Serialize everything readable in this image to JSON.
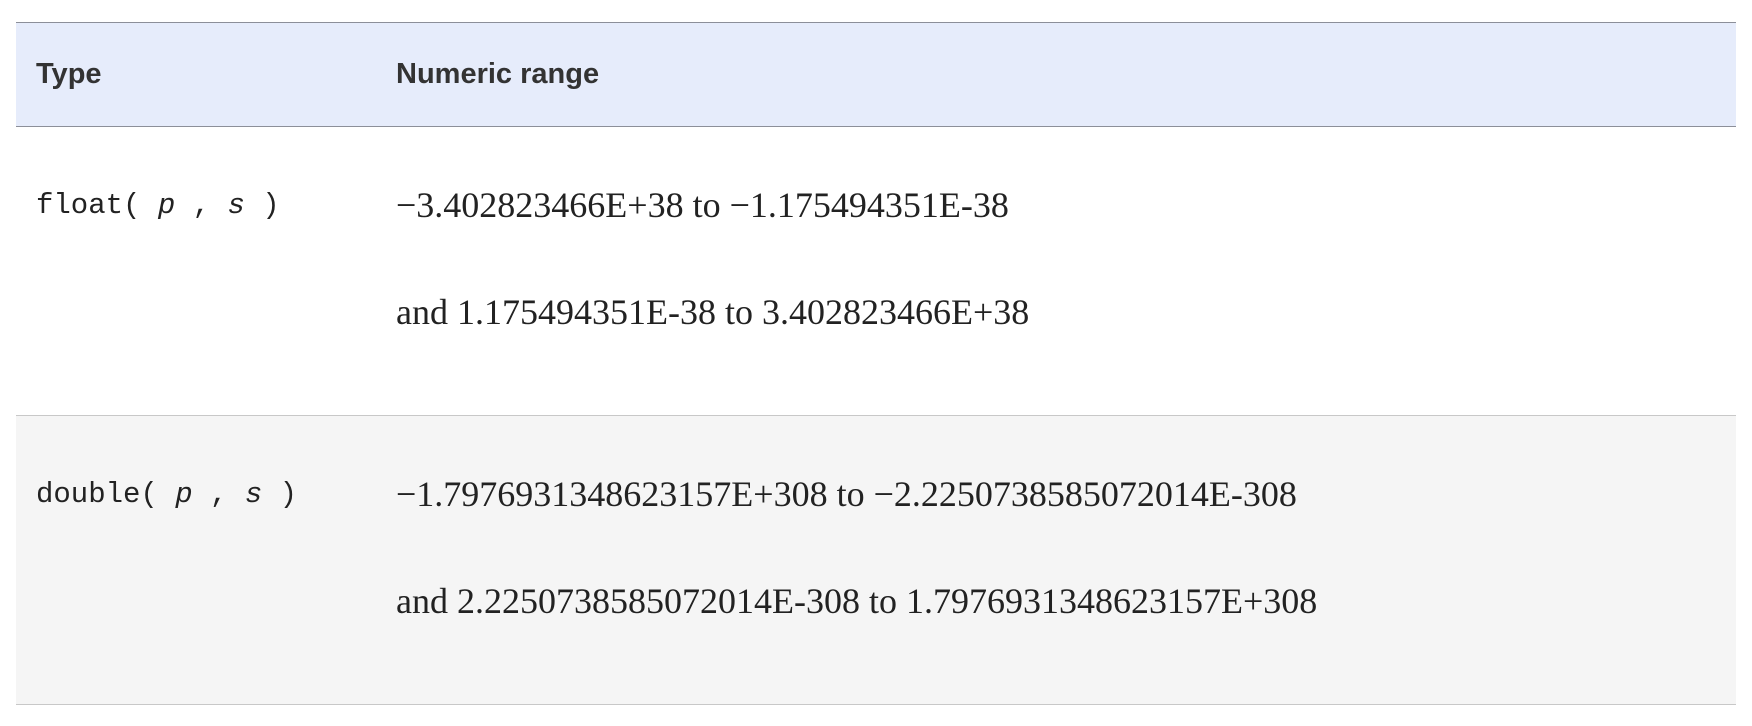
{
  "table": {
    "headers": [
      "Type",
      "Numeric range"
    ],
    "rows": [
      {
        "type_name": "float",
        "type_open": "( ",
        "param_p": "p",
        "separator": " , ",
        "param_s": "s",
        "type_close": " )",
        "range_line_1": "−3.402823466E+38 to −1.175494351E-38",
        "range_line_2": "and 1.175494351E-38 to 3.402823466E+38"
      },
      {
        "type_name": "double",
        "type_open": "( ",
        "param_p": "p",
        "separator": " , ",
        "param_s": "s",
        "type_close": " )",
        "range_line_1": "−1.7976931348623157E+308 to −2.2250738585072014E-308",
        "range_line_2": "and 2.2250738585072014E-308 to 1.7976931348623157E+308"
      }
    ]
  },
  "colors": {
    "header_background": "#e6ecfb",
    "alt_row_background": "#f5f5f5",
    "text": "#222222"
  }
}
